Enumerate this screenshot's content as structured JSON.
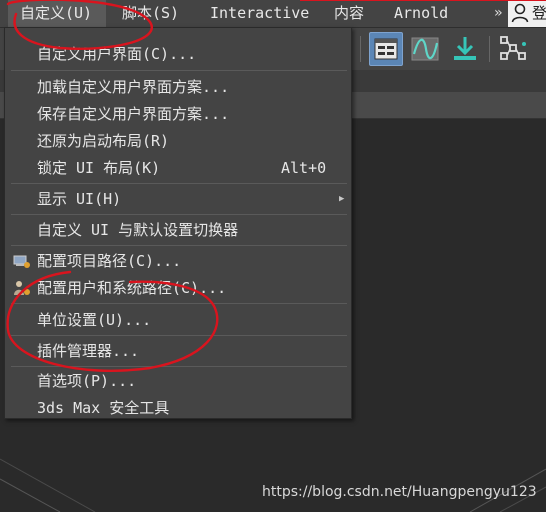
{
  "menubar": {
    "items": [
      "自定义(U)",
      "脚本(S)",
      "Interactive",
      "内容",
      "Arnold"
    ],
    "more": "»",
    "login": "登"
  },
  "menu": {
    "items": [
      {
        "label": "自定义用户界面(C)..."
      },
      {
        "label": "加载自定义用户界面方案..."
      },
      {
        "label": "保存自定义用户界面方案..."
      },
      {
        "label": "还原为启动布局(R)"
      },
      {
        "label": "锁定 UI 布局(K)",
        "shortcut": "Alt+0"
      },
      {
        "label": "显示 UI(H)",
        "submenu": true
      },
      {
        "label": "自定义 UI 与默认设置切换器"
      },
      {
        "label": "配置项目路径(C)...",
        "icon": "project-path-icon"
      },
      {
        "label": "配置用户和系统路径(C)...",
        "icon": "user-path-icon"
      },
      {
        "label": "单位设置(U)..."
      },
      {
        "label": "插件管理器..."
      },
      {
        "label": "首选项(P)..."
      },
      {
        "label": "3ds Max 安全工具"
      }
    ]
  },
  "toolbar": {
    "icons": [
      "scene-explorer-icon",
      "curve-editor-icon",
      "render-setup-icon",
      "schematic-view-icon"
    ]
  },
  "watermark": "https://blog.csdn.net/Huangpengyu123",
  "colors": {
    "menu_bg": "#444444",
    "active_item": "#5a5a5a",
    "annotation_red": "#d9141e",
    "pressed_button": "#5b86b6"
  }
}
